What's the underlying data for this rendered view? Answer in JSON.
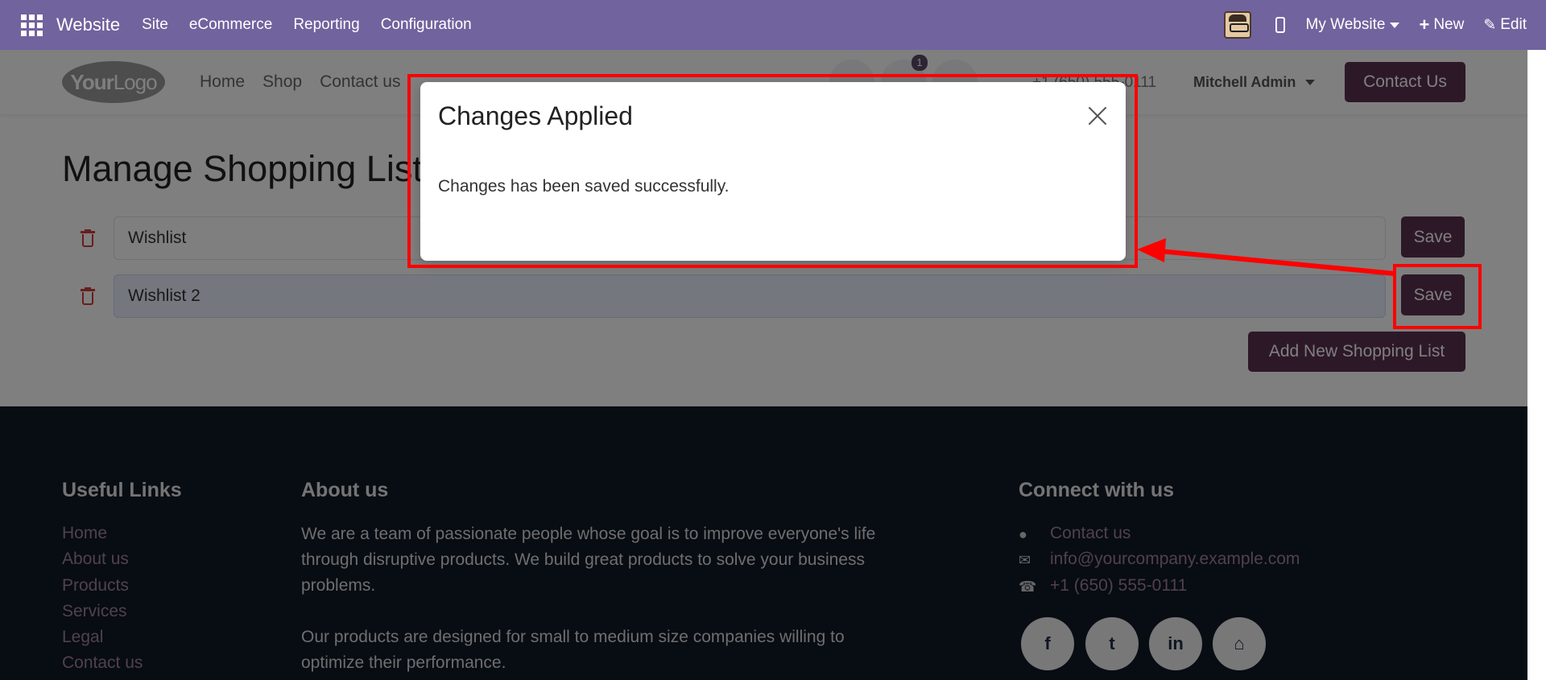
{
  "topbar": {
    "brand": "Website",
    "menus": [
      "Site",
      "eCommerce",
      "Reporting",
      "Configuration"
    ],
    "website_selector": "My Website",
    "new_label": "New",
    "edit_label": "Edit",
    "plus_glyph": "+",
    "pencil_glyph": "✎"
  },
  "header": {
    "logo_bold": "Your",
    "logo_light": "Logo",
    "nav": [
      "Home",
      "Shop",
      "Contact us"
    ],
    "cart_count": "1",
    "phone": "+1 (650) 555-0111",
    "user": "Mitchell Admin",
    "contact_button": "Contact Us"
  },
  "main": {
    "title": "Manage Shopping Lists",
    "lists": [
      {
        "value": "Wishlist",
        "save_label": "Save"
      },
      {
        "value": "Wishlist 2",
        "save_label": "Save"
      }
    ],
    "add_button": "Add New Shopping List"
  },
  "footer": {
    "useful_links_title": "Useful Links",
    "useful_links": [
      "Home",
      "About us",
      "Products",
      "Services",
      "Legal",
      "Contact us"
    ],
    "about_title": "About us",
    "about_p1": "We are a team of passionate people whose goal is to improve everyone's life through disruptive products. We build great products to solve your business problems.",
    "about_p2": "Our products are designed for small to medium size companies willing to optimize their performance.",
    "connect_title": "Connect with us",
    "contact_link": "Contact us",
    "email": "info@yourcompany.example.com",
    "phone": "+1 (650) 555-0111",
    "social_glyphs": {
      "facebook": "f",
      "twitter": "t",
      "linkedin": "in",
      "home": "⌂"
    }
  },
  "dialog": {
    "title": "Changes Applied",
    "body": "Changes has been saved successfully."
  },
  "colors": {
    "topbar": "#71639e",
    "primary_button": "#5b3150",
    "footer_bg": "#111827",
    "annotation": "#ff0000"
  },
  "icons": {
    "apps": "apps-grid-icon",
    "mobile": "mobile-preview-icon",
    "trash": "trash-icon",
    "close": "close-icon",
    "comment": "comment-icon",
    "envelope": "envelope-icon",
    "phone": "phone-icon"
  }
}
